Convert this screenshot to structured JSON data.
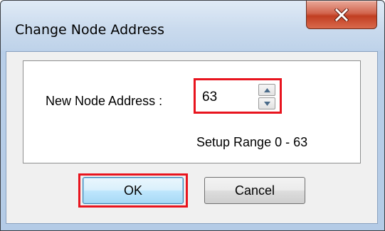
{
  "dialog": {
    "title": "Change Node Address"
  },
  "form": {
    "node_address_label": "New Node Address :",
    "node_address_value": "63",
    "setup_range_text": "Setup Range 0 - 63"
  },
  "buttons": {
    "ok_label": "OK",
    "cancel_label": "Cancel"
  },
  "icons": {
    "close": "close-icon",
    "spin_up": "arrow-up-icon",
    "spin_down": "arrow-down-icon"
  },
  "colors": {
    "highlight": "#e8141e",
    "close_button": "#c13e22",
    "title_bar": "#b9cfe8"
  }
}
